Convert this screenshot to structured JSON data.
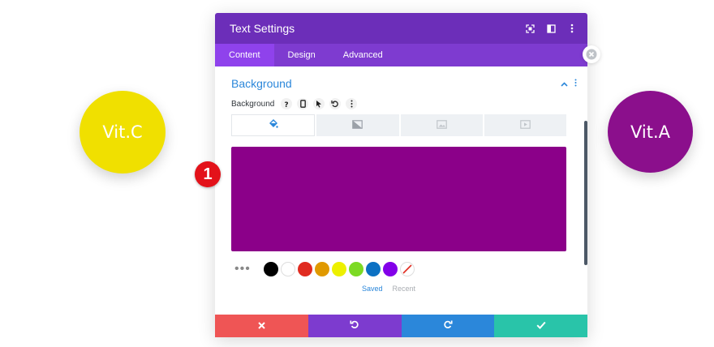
{
  "left_circle": {
    "label": "Vit.C",
    "color": "#f0e000"
  },
  "right_circle": {
    "label": "Vit.A",
    "color": "#8b0f8c"
  },
  "modal": {
    "title": "Text Settings",
    "header_icons": [
      "fullscreen-icon",
      "split-view-icon",
      "more-options-icon"
    ],
    "tabs": [
      {
        "label": "Content",
        "active": true
      },
      {
        "label": "Design",
        "active": false
      },
      {
        "label": "Advanced",
        "active": false
      }
    ],
    "section": {
      "title": "Background",
      "field_label": "Background",
      "field_icons": [
        "help-icon",
        "mobile-icon",
        "cursor-icon",
        "reset-icon",
        "more-icon"
      ],
      "type_tabs": [
        "color-tab",
        "gradient-tab",
        "image-tab",
        "video-tab"
      ],
      "step_badge": "1",
      "selected_color": "#8b0089",
      "palette": [
        "#000000",
        "#ffffff",
        "#e02b20",
        "#e09900",
        "#edf000",
        "#7cda24",
        "#0c71c3",
        "#8300e9"
      ],
      "palette_tabs": {
        "saved": "Saved",
        "recent": "Recent"
      }
    },
    "footer_colors": {
      "cancel": "#ef5555",
      "undo": "#7d3bcf",
      "redo": "#2b87da",
      "save": "#29c4a9"
    }
  }
}
